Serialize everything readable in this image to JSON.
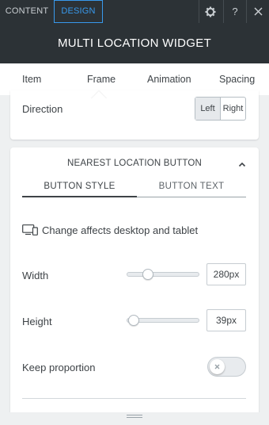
{
  "top_tabs": {
    "content": "CONTENT",
    "design": "DESIGN"
  },
  "toolbar": {
    "gear_icon": "gear-icon",
    "help_label": "?",
    "close_label": "✕"
  },
  "panel_title": "MULTI LOCATION WIDGET",
  "sub_tabs": [
    "Item",
    "Frame",
    "Animation",
    "Spacing"
  ],
  "sub_tab_active": "Frame",
  "direction": {
    "label": "Direction",
    "left": "Left",
    "right": "Right",
    "selected": "Left"
  },
  "nearest": {
    "title": "NEAREST LOCATION BUTTON",
    "tabs": {
      "style": "BUTTON STYLE",
      "text": "BUTTON TEXT",
      "active": "BUTTON STYLE"
    },
    "info": "Change affects desktop and tablet",
    "width": {
      "label": "Width",
      "value": "280px",
      "slider_fraction": 0.26
    },
    "height": {
      "label": "Height",
      "value": "39px",
      "slider_fraction": 0.03
    },
    "keep_proportion": {
      "label": "Keep proportion",
      "on": false
    }
  },
  "colors": {
    "dark": "#2c3236",
    "accent": "#3899ec",
    "text": "#3e4347"
  }
}
